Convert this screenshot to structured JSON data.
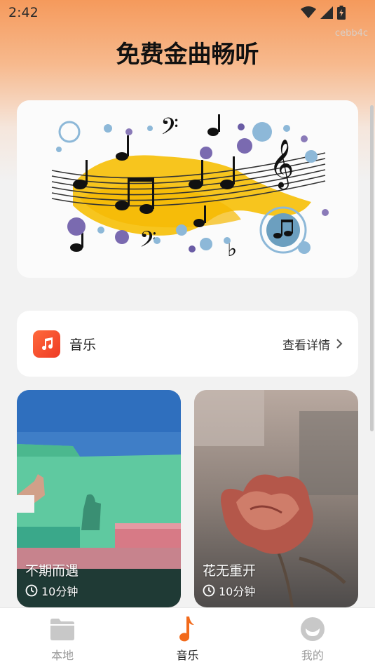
{
  "status_bar": {
    "time": "2:42"
  },
  "watermark": "cebb4c",
  "page_title": "免费金曲畅听",
  "music_entry": {
    "label": "音乐",
    "details_label": "查看详情"
  },
  "song_cards": [
    {
      "title": "不期而遇",
      "duration": "10分钟"
    },
    {
      "title": "花无重开",
      "duration": "10分钟"
    }
  ],
  "tab_bar": {
    "tabs": [
      {
        "label": "本地",
        "icon": "folder-icon",
        "active": false
      },
      {
        "label": "音乐",
        "icon": "music-note-icon",
        "active": true
      },
      {
        "label": "我的",
        "icon": "profile-icon",
        "active": false
      }
    ]
  },
  "colors": {
    "accent": "#f26a1b",
    "gradient_top": "#f59a5c",
    "background": "#f2f2f2",
    "inactive_icon": "#c8c8c8"
  }
}
